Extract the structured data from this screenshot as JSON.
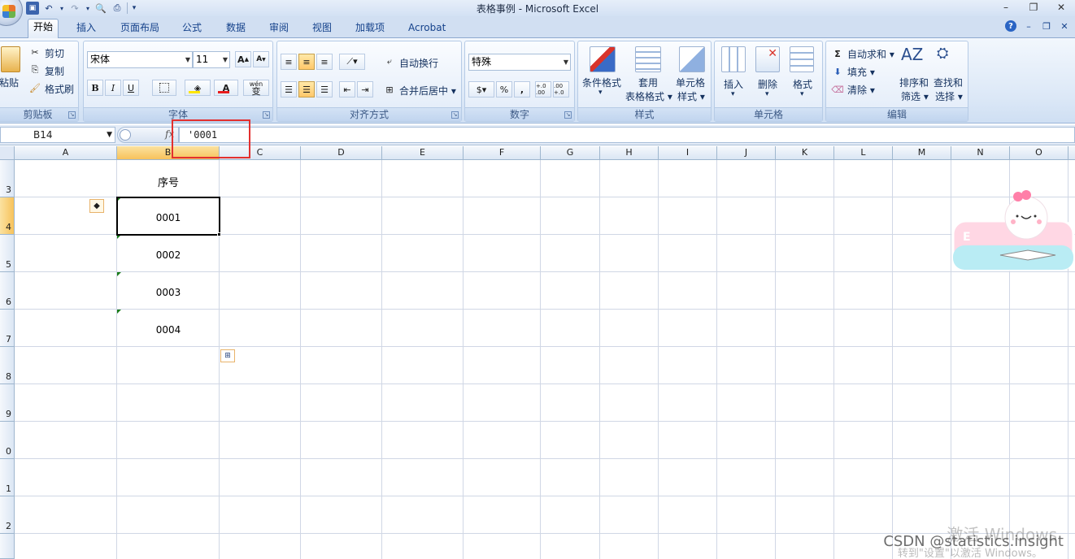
{
  "window": {
    "title": "表格事例 - Microsoft Excel",
    "controls": [
      "–",
      "❐",
      "✕"
    ]
  },
  "quick_access": {
    "overflow": "▾"
  },
  "tabs": [
    {
      "label": "开始",
      "active": true
    },
    {
      "label": "插入"
    },
    {
      "label": "页面布局"
    },
    {
      "label": "公式"
    },
    {
      "label": "数据"
    },
    {
      "label": "审阅"
    },
    {
      "label": "视图"
    },
    {
      "label": "加载项"
    },
    {
      "label": "Acrobat"
    }
  ],
  "ribbon": {
    "clipboard": {
      "group_label": "剪贴板",
      "paste": "粘贴",
      "cut": "剪切",
      "copy": "复制",
      "format_painter": "格式刷"
    },
    "font": {
      "group_label": "字体",
      "font_name": "宋体",
      "font_size": "11",
      "bold": "B",
      "italic": "I",
      "underline": "U",
      "grow": "A",
      "shrink": "A",
      "font_color_glyph": "A",
      "phonetic": "wén",
      "phonetic_char": "变",
      "font_color": "#e81c1c",
      "fill_color": "#ffe600"
    },
    "alignment": {
      "group_label": "对齐方式",
      "wrap_text": "自动换行",
      "merge_center": "合并后居中"
    },
    "number": {
      "group_label": "数字",
      "format": "特殊",
      "percent": "%",
      "comma": ",",
      "increase_decimal": "+.0 .00",
      "decrease_decimal": ".00 +.0"
    },
    "styles": {
      "group_label": "样式",
      "conditional": "条件格式",
      "table_style_line1": "套用",
      "table_style_line2": "表格格式",
      "cell_style_line1": "单元格",
      "cell_style_line2": "样式"
    },
    "cells": {
      "group_label": "单元格",
      "insert": "插入",
      "delete": "删除",
      "format": "格式"
    },
    "editing": {
      "group_label": "编辑",
      "autosum": "自动求和",
      "fill": "填充",
      "clear": "清除",
      "sort_line1": "排序和",
      "sort_line2": "筛选",
      "find_line1": "查找和",
      "find_line2": "选择"
    }
  },
  "formula_bar": {
    "name_box": "B14",
    "fx": "fx",
    "content": "'0001"
  },
  "sheet": {
    "columns": [
      "A",
      "B",
      "C",
      "D",
      "E",
      "F",
      "G",
      "H",
      "I",
      "J",
      "K",
      "L",
      "M",
      "N",
      "O"
    ],
    "rows": [
      "3",
      "4",
      "5",
      "6",
      "7",
      "8",
      "9",
      "0",
      "1",
      "2"
    ],
    "selected_column": "B",
    "selected_row": "4",
    "cells": {
      "B3": "序号",
      "B4": "0001",
      "B5": "0002",
      "B6": "0003",
      "B7": "0004"
    }
  },
  "overlay": {
    "activate_windows": "激活 Windows",
    "activate_hint": "转到\"设置\"以激活 Windows。",
    "csdn": "CSDN @statistics.insight",
    "sticker_letter": "E"
  }
}
